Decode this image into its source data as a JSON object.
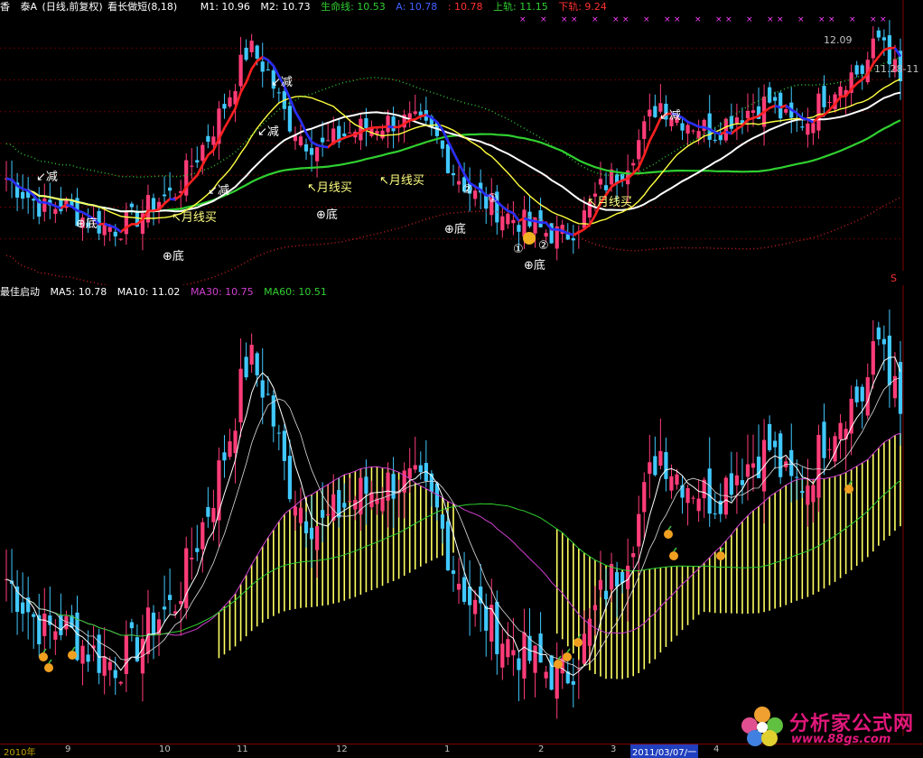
{
  "top_header": {
    "symbol": "香",
    "stock_name": "泰A",
    "period": "(日线,前复权)",
    "indicator": "看长做短(8,18)",
    "m1": "M1: 10.96",
    "m2": "M2: 10.73",
    "life": "生命线: 10.53",
    "a": "A: 10.78",
    "b": ": 10.78",
    "upper": "上轨: 11.15",
    "lower": "下轨: 9.24"
  },
  "bottom_header": {
    "indicator": "最佳启动",
    "ma5": "MA5: 10.78",
    "ma10": "MA10: 11.02",
    "ma30": "MA30: 10.75",
    "ma60": "MA60: 10.51"
  },
  "top_annotations": {
    "jian": "减",
    "di": "底",
    "yuexianmai": "月线买",
    "circle1": "①",
    "circle2": "②",
    "high_label": "12.09",
    "right_label": "11.28-11",
    "sell_marker": "S"
  },
  "x_axis": {
    "labels": [
      "2010年",
      "9",
      "10",
      "11",
      "12",
      "1",
      "2",
      "3",
      "2011/03/07/一",
      "4"
    ]
  },
  "watermark": {
    "title": "分析家公式网",
    "url": "www.88gs.com"
  },
  "colors": {
    "up": "#ff3c78",
    "down": "#40c8ff",
    "m1": "#ff2020",
    "m2": "#2030ff",
    "life": "#30d030",
    "white": "#ffffff",
    "yellow": "#ffff40",
    "dotted_green": "#30c030",
    "dotted_red": "#c02020",
    "ma30": "#d040d0",
    "ma60": "#30d030",
    "fill": "#ffff60",
    "label": "#ffff80"
  },
  "chart_data": [
    {
      "type": "line",
      "title": "看长做短(8,18)",
      "series": [
        {
          "name": "M1",
          "last": 10.96
        },
        {
          "name": "M2",
          "last": 10.73
        },
        {
          "name": "生命线",
          "last": 10.53
        },
        {
          "name": "A",
          "last": 10.78
        },
        {
          "name": "上轨",
          "last": 11.15
        },
        {
          "name": "下轨",
          "last": 9.24
        }
      ],
      "ylim": [
        9.0,
        12.3
      ],
      "annotations": [
        "减",
        "底",
        "月线买",
        "①",
        "②",
        "12.09",
        "11.28-11"
      ]
    },
    {
      "type": "bar",
      "title": "最佳启动",
      "series": [
        {
          "name": "MA5",
          "last": 10.78
        },
        {
          "name": "MA10",
          "last": 11.02
        },
        {
          "name": "MA30",
          "last": 10.75
        },
        {
          "name": "MA60",
          "last": 10.51
        }
      ],
      "ylim": [
        9.0,
        12.3
      ],
      "x_labels": [
        "2010年",
        "9",
        "10",
        "11",
        "12",
        "1",
        "2",
        "3",
        "2011/03/07/一",
        "4"
      ],
      "price_path": [
        10.2,
        10.0,
        9.8,
        9.85,
        9.7,
        9.6,
        9.55,
        9.7,
        9.9,
        10.0,
        10.4,
        10.8,
        11.3,
        11.9,
        11.6,
        11.0,
        10.7,
        10.6,
        10.75,
        10.85,
        10.9,
        10.95,
        10.9,
        10.75,
        10.3,
        10.0,
        9.85,
        9.7,
        9.6,
        9.5,
        9.45,
        9.7,
        10.1,
        10.3,
        10.7,
        11.2,
        11.0,
        10.9,
        10.8,
        11.0,
        11.1,
        11.2,
        10.9,
        10.95,
        11.3,
        11.5,
        11.6,
        12.1,
        11.4
      ]
    }
  ]
}
